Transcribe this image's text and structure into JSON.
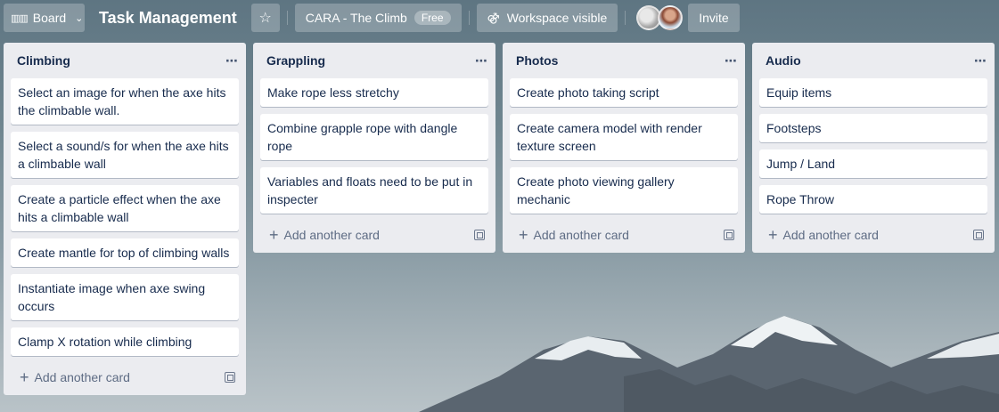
{
  "header": {
    "view_label": "Board",
    "board_title": "Task Management",
    "workspace_name": "CARA - The Climb",
    "workspace_badge": "Free",
    "visibility_label": "Workspace visible",
    "invite_label": "Invite"
  },
  "lists": [
    {
      "title": "Climbing",
      "cards": [
        "Select an image for when the axe hits the climbable wall.",
        "Select a sound/s for when the axe hits a climbable wall",
        "Create a particle effect when the axe hits a climbable wall",
        "Create mantle for top of climbing walls",
        "Instantiate image when axe swing occurs",
        "Clamp X rotation while climbing"
      ],
      "add_label": "Add another card"
    },
    {
      "title": "Grappling",
      "cards": [
        "Make rope less stretchy",
        "Combine grapple rope with dangle rope",
        "Variables and floats need to be put in inspecter"
      ],
      "add_label": "Add another card"
    },
    {
      "title": "Photos",
      "cards": [
        "Create photo taking script",
        "Create camera model with render texture screen",
        "Create photo viewing gallery mechanic"
      ],
      "add_label": "Add another card"
    },
    {
      "title": "Audio",
      "cards": [
        "Equip items",
        "Footsteps",
        "Jump / Land",
        "Rope Throw"
      ],
      "add_label": "Add another card"
    }
  ],
  "icons": {
    "board": "board-icon",
    "star": "star-icon",
    "visibility": "people-icon",
    "list_menu": "ellipsis-icon",
    "add": "plus-icon",
    "template": "card-template-icon"
  }
}
